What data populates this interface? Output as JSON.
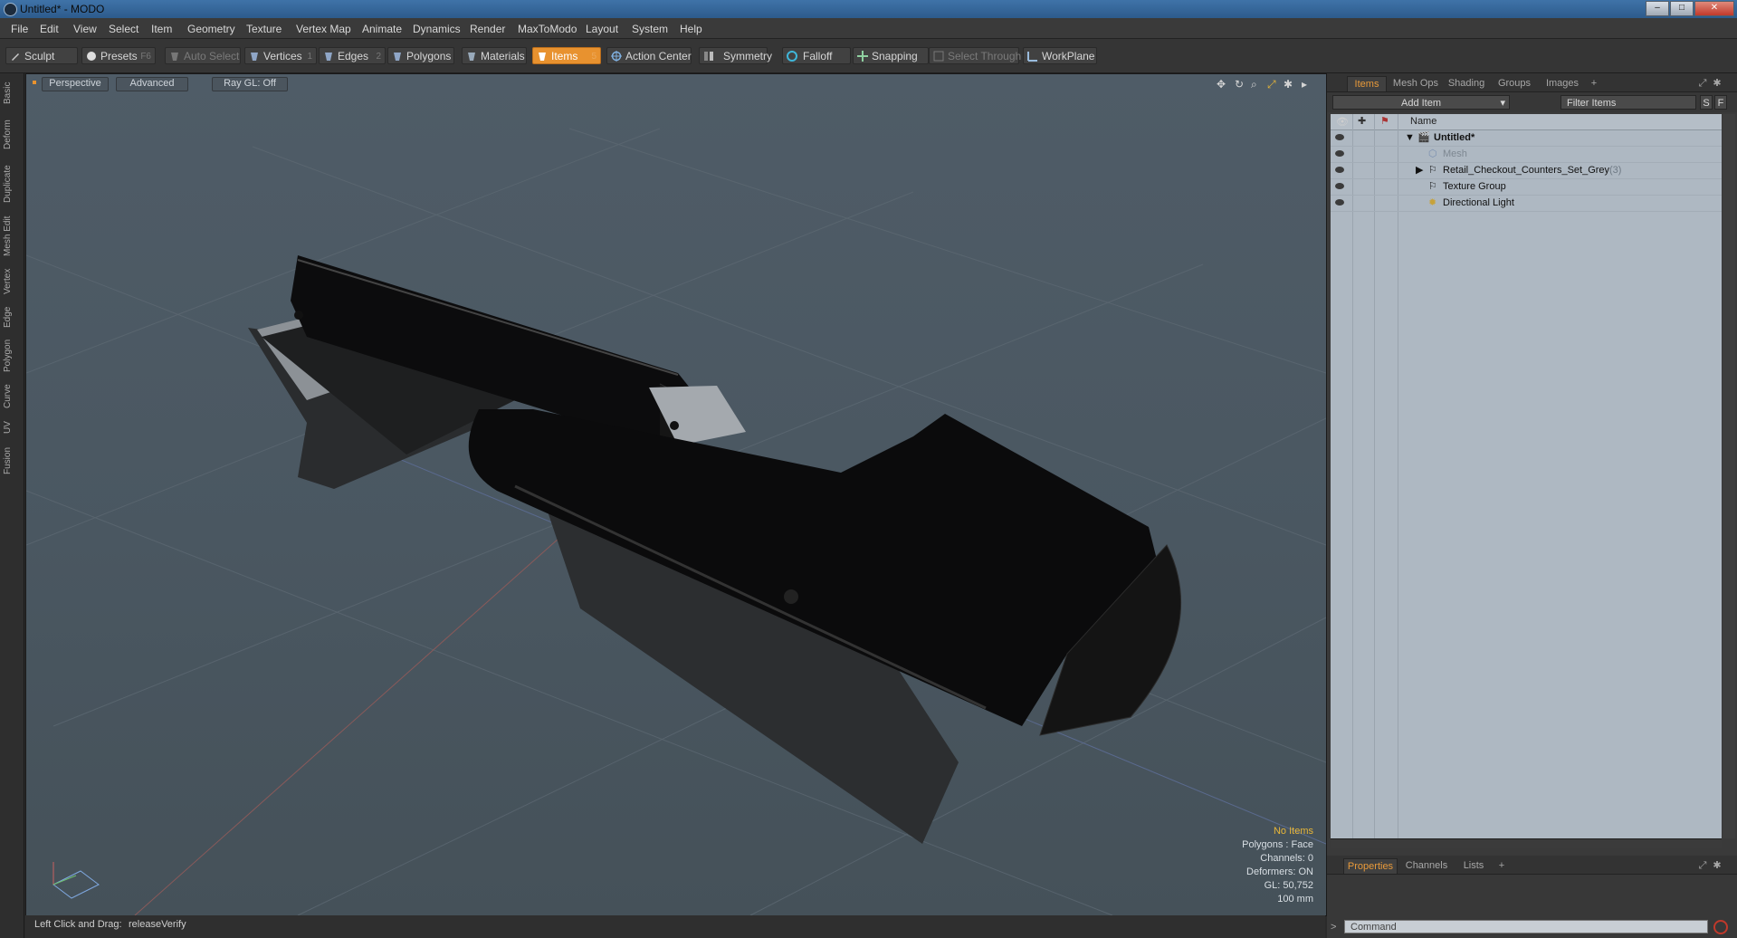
{
  "window": {
    "title": "Untitled* - MODO",
    "minimize": "–",
    "maximize": "□",
    "close": "✕"
  },
  "menu": [
    "File",
    "Edit",
    "View",
    "Select",
    "Item",
    "Geometry",
    "Texture",
    "Vertex Map",
    "Animate",
    "Dynamics",
    "Render",
    "MaxToModo",
    "Layout",
    "System",
    "Help"
  ],
  "toolbar": {
    "sculpt": "Sculpt",
    "presets": "Presets",
    "presets_key": "F6",
    "auto_select": "Auto Select",
    "vertices": "Vertices",
    "vertices_key": "1",
    "edges": "Edges",
    "edges_key": "2",
    "polygons": "Polygons",
    "materials": "Materials",
    "items": "Items",
    "items_key": "5",
    "action_center": "Action Center",
    "symmetry": "Symmetry",
    "falloff": "Falloff",
    "snapping": "Snapping",
    "select_through": "Select Through",
    "workplane": "WorkPlane"
  },
  "left_tabs": [
    "Basic",
    "Deform",
    "Duplicate",
    "Mesh Edit",
    "Vertex",
    "Edge",
    "Polygon",
    "Curve",
    "UV",
    "Fusion"
  ],
  "viewport": {
    "view": "Perspective",
    "shading": "Advanced",
    "raygl": "Ray GL: Off",
    "hud": {
      "selection": "No Items",
      "polygons": "Polygons : Face",
      "channels": "Channels: 0",
      "deformers": "Deformers: ON",
      "gl": "GL: 50,752",
      "scale": "100 mm"
    },
    "icons": [
      "move-view-icon",
      "rotate-view-icon",
      "zoom-view-icon",
      "fit-view-icon",
      "settings-icon",
      "expand-icon"
    ]
  },
  "status": {
    "hint_label": "Left Click and Drag:",
    "hint_action": "releaseVerify"
  },
  "panel": {
    "tabs": [
      "Items",
      "Mesh Ops",
      "Shading",
      "Groups",
      "Images"
    ],
    "add_tab": "+",
    "add_item": "Add Item",
    "filter_placeholder": "Filter Items",
    "s_btn": "S",
    "f_btn": "F",
    "column_name": "Name",
    "tree": [
      {
        "label": "Untitled*",
        "bold": true
      },
      {
        "label": "Mesh",
        "dim": true
      },
      {
        "label": "Retail_Checkout_Counters_Set_Grey",
        "count": "(3)"
      },
      {
        "label": "Texture Group"
      },
      {
        "label": "Directional Light"
      }
    ]
  },
  "bottom_panel": {
    "tabs": [
      "Properties",
      "Channels",
      "Lists"
    ],
    "add_tab": "+"
  },
  "command": {
    "placeholder": "Command"
  }
}
